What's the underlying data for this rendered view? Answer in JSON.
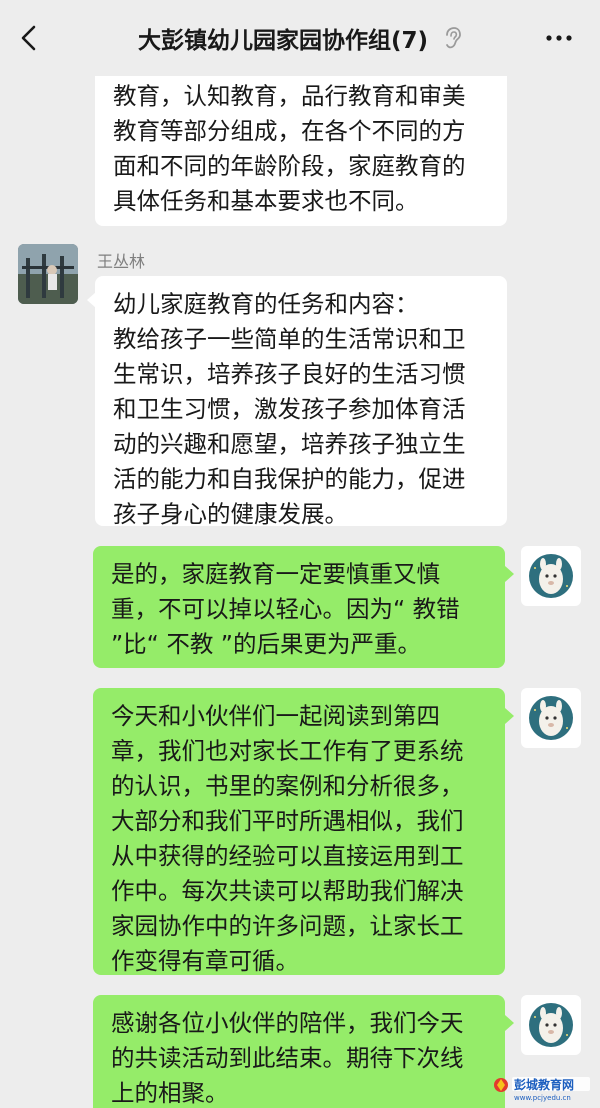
{
  "header": {
    "back_icon": "chevron-left-icon",
    "title": "大彭镇幼儿园家园协作组(7)",
    "mute_icon": "ear-icon",
    "more_icon": "more-dots-icon"
  },
  "messages": [
    {
      "side": "left",
      "text": "家庭教育的任务和内容主要由健康\n教育，认知教育，品行教育和审美\n教育等部分组成，在各个不同的方\n面和不同的年龄阶段，家庭教育的\n具体任务和基本要求也不同。"
    },
    {
      "side": "left",
      "sender": "王丛林",
      "text": "幼儿家庭教育的任务和内容：\n教给孩子一些简单的生活常识和卫\n生常识，培养孩子良好的生活习惯\n和卫生习惯，激发孩子参加体育活\n动的兴趣和愿望，培养孩子独立生\n活的能力和自我保护的能力，促进\n孩子身心的健康发展。"
    },
    {
      "side": "right",
      "text": "是的，家庭教育一定要慎重又慎\n重，不可以掉以轻心。因为“ 教错\n”比“ 不教 ”的后果更为严重。"
    },
    {
      "side": "right",
      "text": "今天和小伙伴们一起阅读到第四\n章，我们也对家长工作有了更系统\n的认识，书里的案例和分析很多，\n大部分和我们平时所遇相似，我们\n从中获得的经验可以直接运用到工\n作中。每次共读可以帮助我们解决\n家园协作中的许多问题，让家长工\n作变得有章可循。"
    },
    {
      "side": "right",
      "text": "感谢各位小伙伴的陪伴，我们今天\n的共读活动到此结束。期待下次线\n上的相聚。"
    }
  ],
  "watermark": {
    "name": "彭城教育网",
    "url": "www.pcjyedu.cn"
  },
  "colors": {
    "background": "#ededed",
    "bubble_self": "#95ec69",
    "bubble_other": "#ffffff",
    "text": "#191919",
    "sender": "#7f7f7f"
  }
}
